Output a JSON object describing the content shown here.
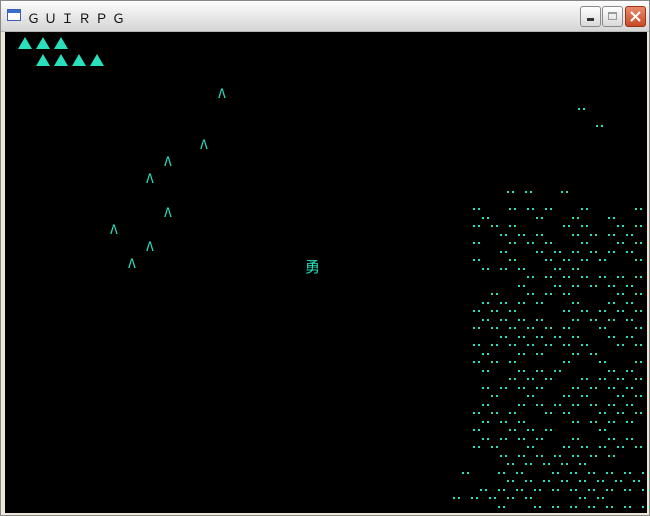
{
  "window": {
    "title": "ＧＵＩＲＰＧ",
    "controls": [
      "minimize",
      "maximize",
      "close"
    ]
  },
  "game": {
    "background_color": "#000000",
    "accent_color": "#29e0bd",
    "hud": {
      "icon_name": "filled-triangle-icon",
      "row1_count": 3,
      "row2_count": 4
    },
    "player": {
      "glyph": "勇"
    },
    "mountain_glyph": "Λ",
    "terrain_dot_glyph": "··"
  }
}
